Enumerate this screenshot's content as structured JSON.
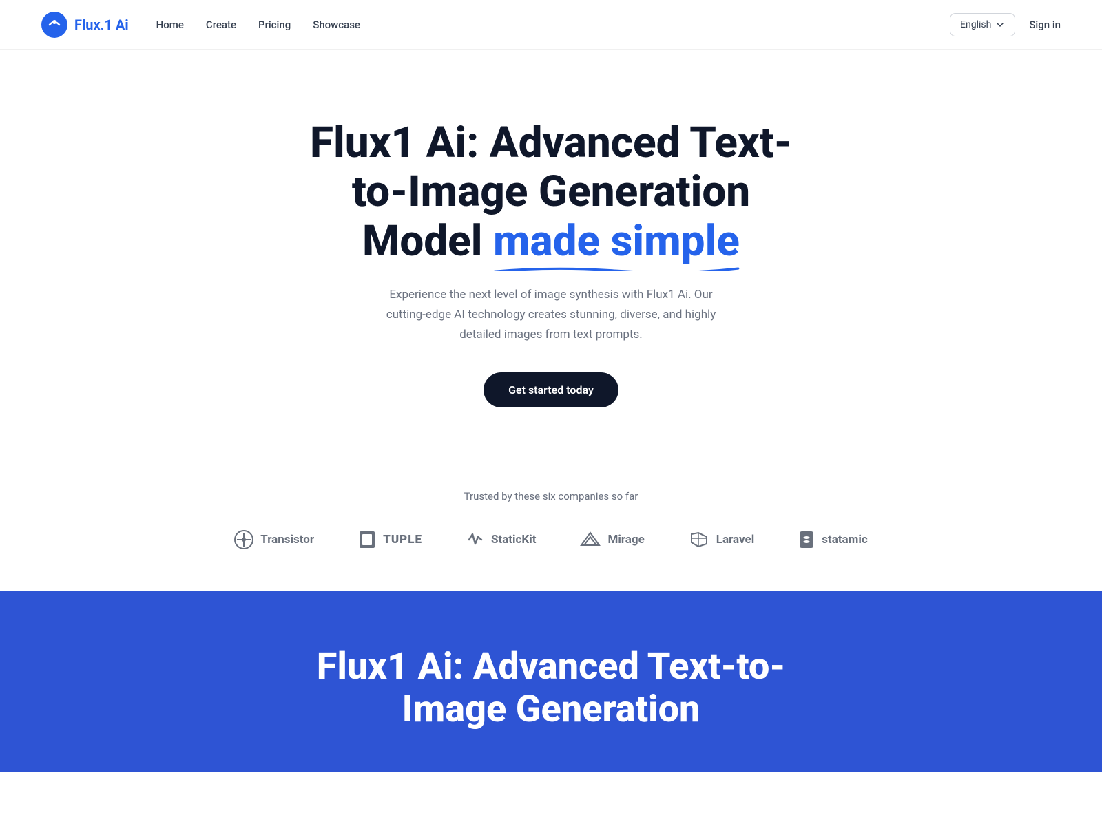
{
  "nav": {
    "logo_text_main": "Flux.1 ",
    "logo_text_accent": "Ai",
    "links": [
      {
        "label": "Home",
        "href": "#"
      },
      {
        "label": "Create",
        "href": "#"
      },
      {
        "label": "Pricing",
        "href": "#"
      },
      {
        "label": "Showcase",
        "href": "#"
      }
    ],
    "language": "English",
    "sign_in": "Sign in"
  },
  "hero": {
    "title_line1": "Flux1 Ai: Advanced Text-to-Image Generation",
    "title_plain": "Model ",
    "title_highlight": "made simple",
    "subtitle": "Experience the next level of image synthesis with Flux1 Ai. Our cutting-edge AI technology creates stunning, diverse, and highly detailed images from text prompts.",
    "cta_label": "Get started today"
  },
  "trusted": {
    "label": "Trusted by these six companies so far",
    "companies": [
      {
        "name": "Transistor",
        "icon": "transistor"
      },
      {
        "name": "TUPLE",
        "icon": "tuple"
      },
      {
        "name": "StaticKit",
        "icon": "statickit"
      },
      {
        "name": "Mirage",
        "icon": "mirage"
      },
      {
        "name": "Laravel",
        "icon": "laravel"
      },
      {
        "name": "statamic",
        "icon": "statamic"
      }
    ]
  },
  "blue_section": {
    "title": "Flux1 Ai: Advanced Text-to-Image Generation"
  }
}
